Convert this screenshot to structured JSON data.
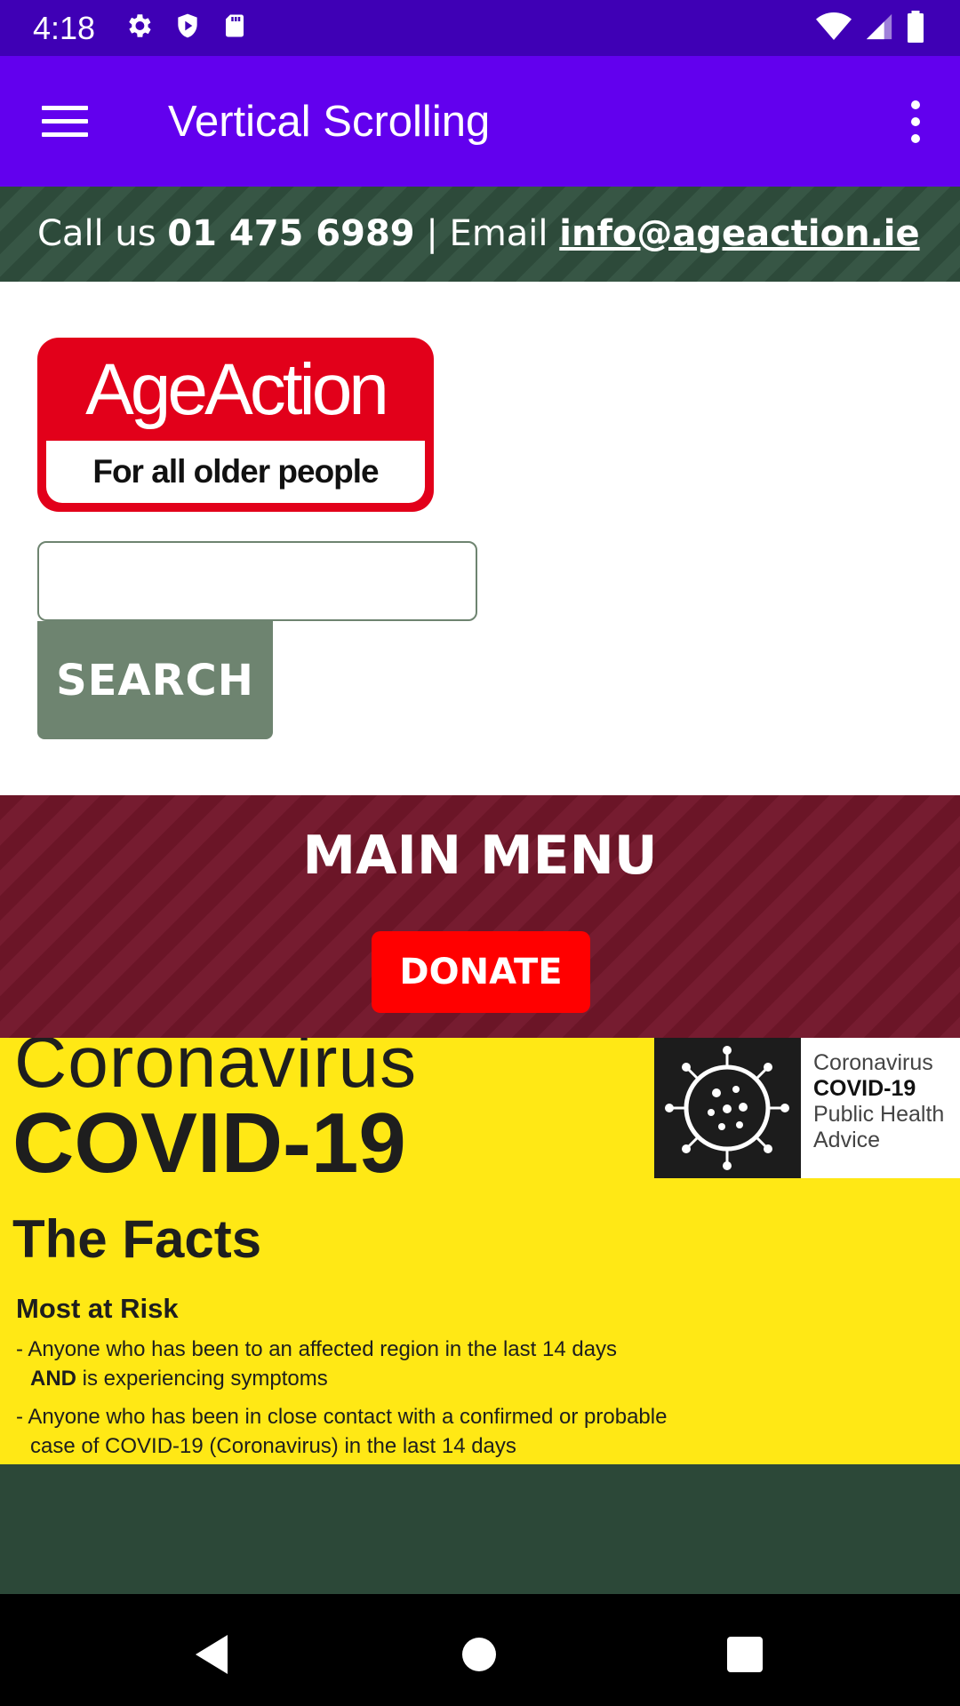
{
  "status_bar": {
    "time": "4:18",
    "icons": [
      "gear-icon",
      "shield-icon",
      "sd-card-icon",
      "wifi-icon",
      "signal-icon",
      "battery-icon"
    ]
  },
  "app_bar": {
    "title": "Vertical Scrolling",
    "color": "#6200ee"
  },
  "contact": {
    "call_prefix": "Call us ",
    "phone": "01 475 6989",
    "separator": " | ",
    "email_prefix": "Email ",
    "email": "info@ageaction.ie"
  },
  "logo": {
    "top": "AgeAction",
    "bottom": "For all older people"
  },
  "search": {
    "value": "",
    "button_label": "SEARCH"
  },
  "main_menu": {
    "title": "MAIN MENU",
    "donate_label": "DONATE"
  },
  "covid_banner": {
    "line1": "Coronavirus",
    "line2": "COVID-19",
    "line3": "The Facts",
    "line4": "Most at Risk",
    "bullet1_a": "Anyone who has been to an affected region in the last 14 days",
    "bullet1_b_bold": "AND",
    "bullet1_b_rest": " is experiencing symptoms",
    "bullet2": "Anyone who has been in close contact with a confirmed or probable case of COVID-19 (Coronavirus) in the last 14 days",
    "hse_l1": "Coronavirus",
    "hse_l2": "COVID-19",
    "hse_l3": "Public Health",
    "hse_l4": "Advice"
  },
  "colors": {
    "status_bar": "#3f00b5",
    "contact_bar": "#2d4a3a",
    "main_menu": "#6b1527",
    "donate": "#ff0000",
    "search_button": "#6e8470",
    "covid_yellow": "#ffe815"
  }
}
